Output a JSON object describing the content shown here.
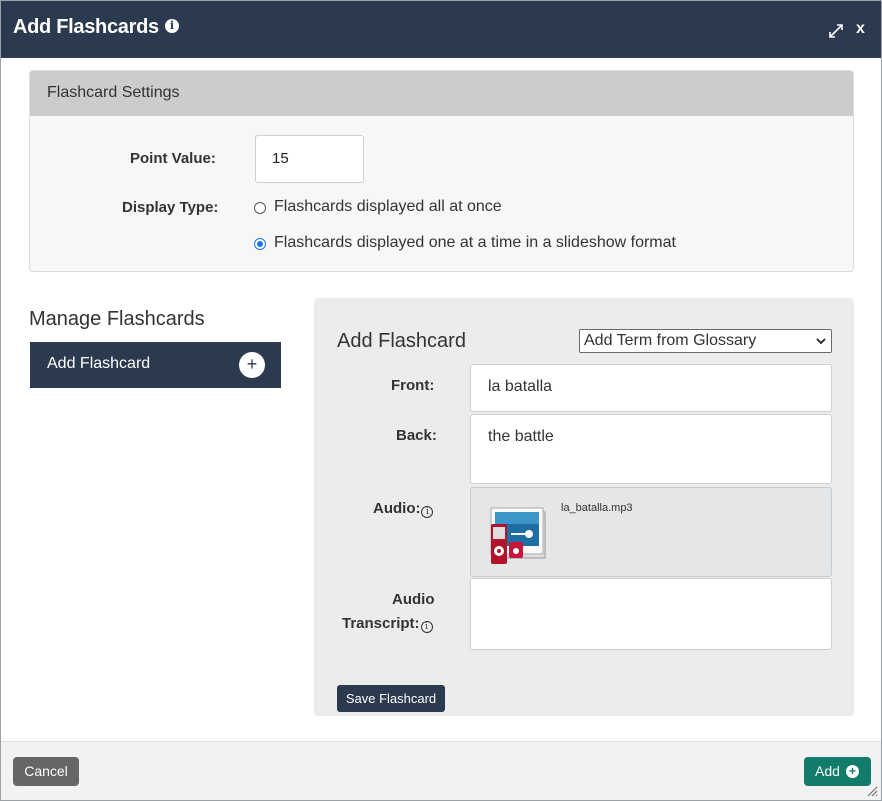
{
  "dialog": {
    "title": "Add Flashcards",
    "info_icon": "info-icon",
    "expand_icon": "expand-icon",
    "close_label": "x"
  },
  "settings": {
    "header": "Flashcard Settings",
    "point_value_label": "Point Value:",
    "point_value": "15",
    "display_type_label": "Display Type:",
    "options": [
      {
        "label": "Flashcards displayed all at once",
        "selected": false
      },
      {
        "label": "Flashcards displayed one at a time in a slideshow format",
        "selected": true
      }
    ]
  },
  "manage": {
    "title": "Manage Flashcards",
    "add_button_label": "Add Flashcard",
    "add_button_icon": "plus-icon"
  },
  "panel": {
    "title": "Add Flashcard",
    "glossary_select": "Add Term from Glossary",
    "front_label": "Front:",
    "front_value": "la batalla",
    "back_label": "Back:",
    "back_value": "the battle",
    "audio_label": "Audio:",
    "audio_file": "la_batalla.mp3",
    "audio_transcript_label_1": "Audio",
    "audio_transcript_label_2": "Transcript:",
    "audio_transcript_value": "",
    "save_button": "Save Flashcard"
  },
  "footer": {
    "cancel_label": "Cancel",
    "add_label": "Add"
  },
  "colors": {
    "titlebar": "#2b3a4e",
    "add_button": "#127c6b",
    "cancel_button": "#666666",
    "radio_selected": "#1a73e8"
  }
}
